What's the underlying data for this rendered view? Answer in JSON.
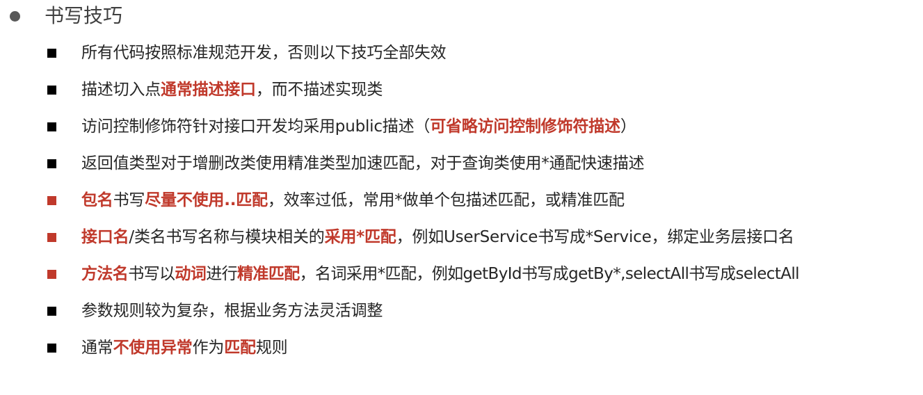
{
  "title": "书写技巧",
  "colors": {
    "accent": "#c0392b",
    "text": "#262626",
    "bullet": "#000000"
  },
  "items": [
    {
      "bullet": "square-black",
      "segments": [
        {
          "text": "所有代码按照标准规范开发，否则以下技巧全部失效"
        }
      ]
    },
    {
      "bullet": "square-black",
      "segments": [
        {
          "text": "描述切入点"
        },
        {
          "text": "通常描述接口",
          "bold": true
        },
        {
          "text": "，而不描述实现类"
        }
      ]
    },
    {
      "bullet": "square-black",
      "segments": [
        {
          "text": "访问控制修饰符针对接口开发均采用public描述（"
        },
        {
          "text": "可省略访问控制修饰符描述",
          "bold": true
        },
        {
          "text": "）"
        }
      ]
    },
    {
      "bullet": "square-black",
      "segments": [
        {
          "text": "返回值类型对于增删改类使用精准类型加速匹配，对于查询类使用*通配快速描述"
        }
      ]
    },
    {
      "bullet": "square-red",
      "segments": [
        {
          "text": "包名",
          "bold": true
        },
        {
          "text": "书写"
        },
        {
          "text": "尽量不使用..匹配",
          "bold": true
        },
        {
          "text": "，效率过低，常用*做单个包描述匹配，或精准匹配"
        }
      ]
    },
    {
      "bullet": "square-red",
      "segments": [
        {
          "text": "接口名",
          "bold": true
        },
        {
          "text": "/类名书写名称与模块相关的"
        },
        {
          "text": "采用*匹配",
          "bold": true
        },
        {
          "text": "，例如UserService书写成*Service，绑定业务层接口名"
        }
      ]
    },
    {
      "bullet": "square-red",
      "segments": [
        {
          "text": "方法名",
          "bold": true
        },
        {
          "text": "书写以"
        },
        {
          "text": "动词",
          "bold": true
        },
        {
          "text": "进行"
        },
        {
          "text": "精准匹配",
          "bold": true
        },
        {
          "text": "，名词采用*匹配，例如getById书写成getBy*,selectAll书写成selectAll"
        }
      ]
    },
    {
      "bullet": "square-black",
      "segments": [
        {
          "text": "参数规则较为复杂，根据业务方法灵活调整"
        }
      ]
    },
    {
      "bullet": "square-black",
      "segments": [
        {
          "text": "通常"
        },
        {
          "text": "不使用异常",
          "bold": true
        },
        {
          "text": "作为"
        },
        {
          "text": "匹配",
          "bold": true
        },
        {
          "text": "规则"
        }
      ]
    }
  ]
}
